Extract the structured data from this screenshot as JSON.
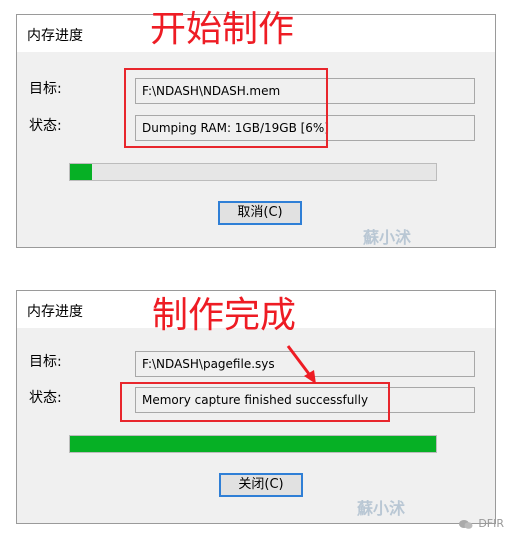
{
  "dialog1": {
    "title": "内存进度",
    "target_label": "目标:",
    "target_value": "F:\\NDASH\\NDASH.mem",
    "status_label": "状态:",
    "status_value": "Dumping RAM: 1GB/19GB [6%]",
    "progress_fraction": 0.06,
    "button_label": "取消(C)",
    "watermark": "蘇小沭",
    "annotation": "开始制作"
  },
  "dialog2": {
    "title": "内存进度",
    "target_label": "目标:",
    "target_value": "F:\\NDASH\\pagefile.sys",
    "status_label": "状态:",
    "status_value": "Memory capture finished successfully",
    "progress_fraction": 1.0,
    "button_label": "关闭(C)",
    "watermark": "蘇小沭",
    "annotation": "制作完成"
  },
  "footer": {
    "text": "DFIR"
  },
  "colors": {
    "progress": "#06b025",
    "annotation": "#ee1c24",
    "button_border": "#2f7fd6"
  }
}
